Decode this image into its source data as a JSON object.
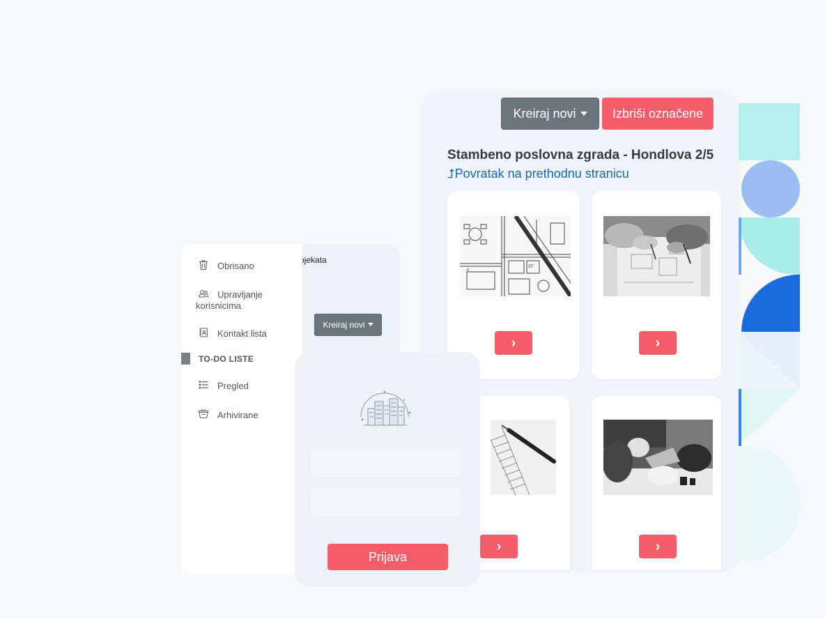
{
  "colors": {
    "accent_red": "#f35c68",
    "secondary_gray": "#6c757d",
    "link_blue": "#1767b3",
    "panel_bg": "#f0f3f7"
  },
  "project_view": {
    "create_new_label": "Kreiraj novi",
    "delete_selected_label": "Izbriši označene",
    "title": "Stambeno poslovna zgrada - Hondlova 2/5",
    "back_icon": "arrow-up-icon",
    "back_arrow": "⮥",
    "back_link": "Povratak na prethodnu stranicu",
    "cards": [
      {
        "image": "floor-plan-photo",
        "button_icon": "chevron-right-icon"
      },
      {
        "image": "hands-drafting-photo",
        "button_icon": "chevron-right-icon"
      },
      {
        "image": "blueprint-pen-photo",
        "button_icon": "chevron-right-icon"
      },
      {
        "image": "hardhat-meeting-photo",
        "button_icon": "chevron-right-icon"
      }
    ],
    "chevron": "›"
  },
  "mid_panel": {
    "fragment_text": "ojekata",
    "create_new_label": "Kreiraj novi"
  },
  "sidebar": {
    "items": [
      {
        "label": "Obrisano",
        "icon": "trash-icon"
      },
      {
        "label": "Upravljanje korisnicima",
        "icon": "users-icon"
      },
      {
        "label": "Kontakt lista",
        "icon": "contact-book-icon"
      }
    ],
    "section_header": "TO-DO LISTE",
    "todo_items": [
      {
        "label": "Pregled",
        "icon": "list-icon"
      },
      {
        "label": "Arhivirane",
        "icon": "archive-basket-icon"
      }
    ]
  },
  "login": {
    "logo_icon": "city-skyline-logo-icon",
    "username_value": "",
    "password_value": "",
    "submit_label": "Prijava"
  }
}
